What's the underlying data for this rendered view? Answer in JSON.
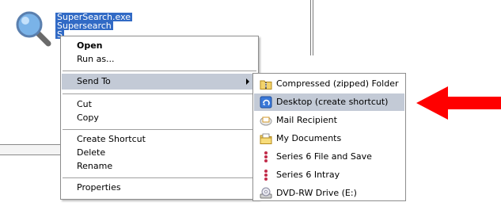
{
  "file": {
    "name_lines": [
      "SuperSearch.exe",
      "Supersearch",
      "S"
    ]
  },
  "context_menu": {
    "items": [
      {
        "label": "Open",
        "bold": true
      },
      {
        "label": "Run as..."
      },
      {
        "label": "Send To",
        "highlighted": true,
        "has_submenu": true
      },
      {
        "label": "Cut"
      },
      {
        "label": "Copy"
      },
      {
        "label": "Create Shortcut"
      },
      {
        "label": "Delete"
      },
      {
        "label": "Rename"
      },
      {
        "label": "Properties"
      }
    ]
  },
  "send_to_menu": {
    "items": [
      {
        "label": "Compressed (zipped) Folder",
        "icon": "zip-folder-icon"
      },
      {
        "label": "Desktop (create shortcut)",
        "icon": "desktop-icon",
        "highlighted": true
      },
      {
        "label": "Mail Recipient",
        "icon": "mail-icon"
      },
      {
        "label": "My Documents",
        "icon": "documents-folder-icon"
      },
      {
        "label": "Series 6 File and Save",
        "icon": "series-icon"
      },
      {
        "label": "Series 6 Intray",
        "icon": "series-icon"
      },
      {
        "label": "DVD-RW Drive (E:)",
        "icon": "dvd-drive-icon"
      }
    ]
  },
  "colors": {
    "selection": "#316ac5",
    "menu_highlight": "#c3cad6",
    "annotation_arrow": "#ff0000"
  }
}
